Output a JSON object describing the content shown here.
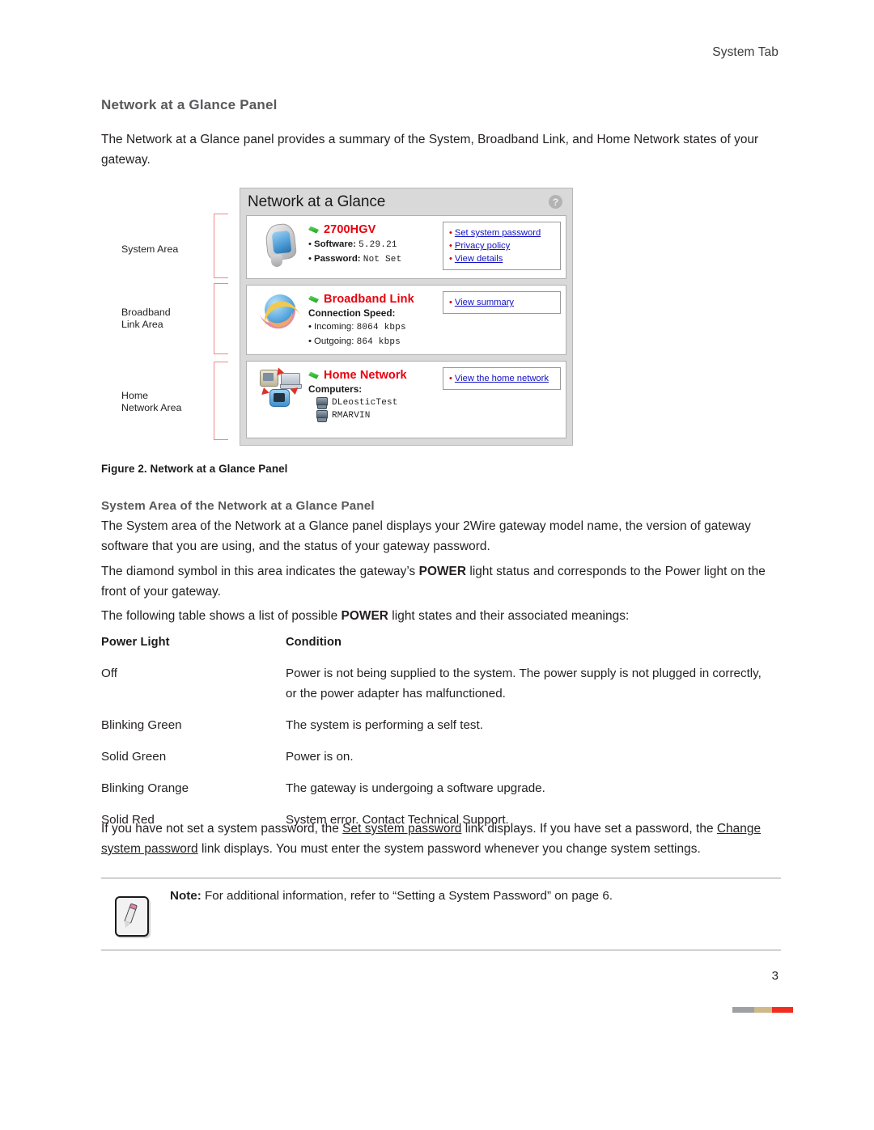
{
  "running_head": "System Tab",
  "section_title": "Network at a Glance Panel",
  "intro_paragraph": "The Network at a Glance panel provides a summary of the System, Broadband Link, and Home Network states of your gateway.",
  "figure": {
    "callouts": {
      "system": "System Area",
      "broadband_line1": "Broadband",
      "broadband_line2": "Link Area",
      "home_line1": "Home",
      "home_line2": "Network Area"
    },
    "panel_title": "Network at a Glance",
    "help_icon_label": "?",
    "system_row": {
      "heading": "2700HGV",
      "details": [
        {
          "label": "Software:",
          "value": "5.29.21"
        },
        {
          "label": "Password:",
          "value": "Not Set"
        }
      ],
      "links": [
        "Set system password",
        "Privacy policy",
        "View details"
      ]
    },
    "broadband_row": {
      "heading": "Broadband Link",
      "sub_heading": "Connection Speed:",
      "details": [
        {
          "label": "Incoming:",
          "value": "8064 kbps"
        },
        {
          "label": "Outgoing:",
          "value": "864 kbps"
        }
      ],
      "links": [
        "View summary"
      ]
    },
    "home_row": {
      "heading": "Home Network",
      "sub_heading": "Computers:",
      "computers": [
        "DLeosticTest",
        "RMARVIN"
      ],
      "links": [
        "View the home network"
      ]
    }
  },
  "figure_caption": "Figure 2. Network at a Glance Panel",
  "sub_section_title": "System Area of the Network at a Glance Panel",
  "paragraph_2": "The System area of the Network at a Glance panel displays your 2Wire gateway model name, the version of gateway software that you are using, and the status of your gateway password.",
  "paragraph_3_part1": "The diamond symbol in this area indicates the gateway’s ",
  "paragraph_3_bold": "POWER",
  "paragraph_3_part2": " light status and corresponds to the Power light on the front of your gateway.",
  "paragraph_4_part1": "The following table shows a list of possible ",
  "paragraph_4_bold": "POWER",
  "paragraph_4_part2": " light states and their associated meanings:",
  "power_table": {
    "headers": [
      "Power Light",
      "Condition"
    ],
    "rows": [
      {
        "light": "Off",
        "condition": "Power is not being supplied to the system. The power supply is not plugged in correctly, or the power adapter has malfunctioned."
      },
      {
        "light": "Blinking Green",
        "condition": "The system is performing a self test."
      },
      {
        "light": "Solid Green",
        "condition": "Power is on."
      },
      {
        "light": "Blinking Orange",
        "condition": "The gateway is undergoing a software upgrade."
      },
      {
        "light": "Solid Red",
        "condition": "System error. Contact Technical Support."
      }
    ]
  },
  "paragraph_5": {
    "part1": "If you have not set a system password, the ",
    "link1": "Set system password",
    "part2": " link displays. If you have set a password, the ",
    "link2": "Change system password",
    "part3": " link displays. You must enter the system password whenever you change system settings."
  },
  "note": {
    "label": "Note:",
    "text": " For additional information, refer to “Setting a System Password” on page 6."
  },
  "page_number": "3",
  "colors": {
    "heading_gray": "#58595b",
    "link_red": "#e8000d",
    "link_blue": "#1212c4",
    "bracket_pink": "#f4868a",
    "footer_gray": "#9fa0a4",
    "footer_tan": "#cdb98a",
    "footer_red": "#f12d20"
  }
}
